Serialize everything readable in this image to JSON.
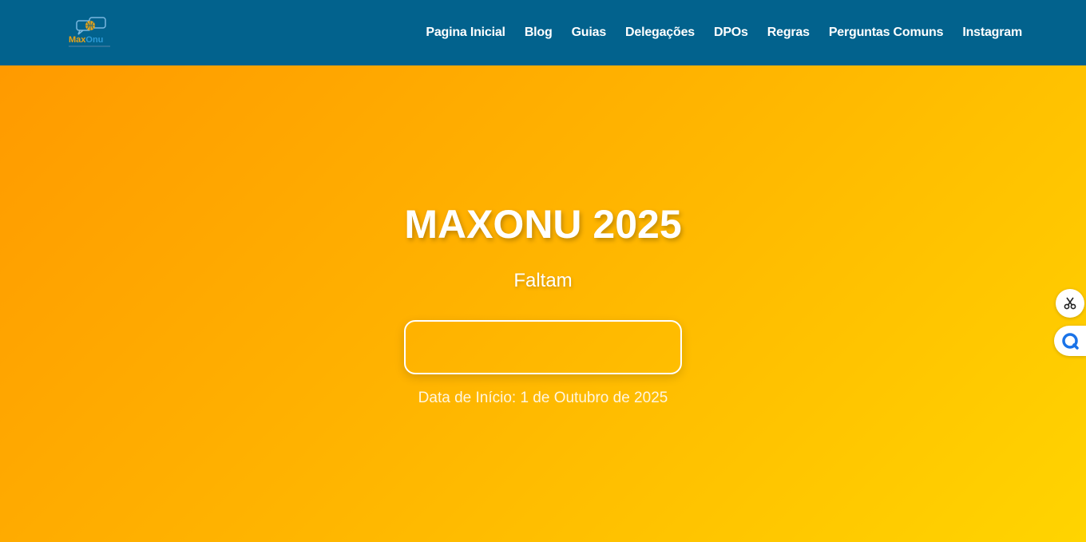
{
  "nav": {
    "logo": {
      "name_part1": "Max",
      "name_part2": "Onu"
    },
    "links": [
      "Pagina Inicial",
      "Blog",
      "Guias",
      "Delegações",
      "DPOs",
      "Regras",
      "Perguntas Comuns",
      "Instagram"
    ]
  },
  "hero": {
    "title": "MAXONU 2025",
    "subtitle": "Faltam",
    "countdown_value": "",
    "start_date": "Data de Início: 1 de Outubro de 2025"
  },
  "colors": {
    "navbar": "#02628d",
    "gradient_start": "#ff9a00",
    "gradient_end": "#ffd400"
  },
  "side_buttons": {
    "scissors_icon": "scissors-icon",
    "chat_icon": "chat-icon"
  }
}
